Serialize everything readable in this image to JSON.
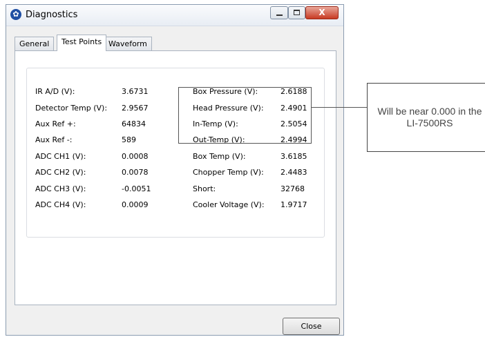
{
  "window": {
    "title": "Diagnostics",
    "close_glyph": "X"
  },
  "tabs": [
    {
      "label": "General"
    },
    {
      "label": "Test Points"
    },
    {
      "label": "Waveform"
    }
  ],
  "test_points": {
    "left": [
      {
        "label": "IR A/D (V):",
        "value": "3.6731"
      },
      {
        "label": "Detector Temp (V):",
        "value": "2.9567"
      },
      {
        "label": "Aux Ref +:",
        "value": "64834"
      },
      {
        "label": "Aux Ref -:",
        "value": "589"
      },
      {
        "label": "ADC CH1 (V):",
        "value": "0.0008"
      },
      {
        "label": "ADC CH2 (V):",
        "value": "0.0078"
      },
      {
        "label": "ADC CH3 (V):",
        "value": "-0.0051"
      },
      {
        "label": "ADC CH4 (V):",
        "value": "0.0009"
      }
    ],
    "right": [
      {
        "label": "Box Pressure (V):",
        "value": "2.6188"
      },
      {
        "label": "Head Pressure (V):",
        "value": "2.4901"
      },
      {
        "label": "In-Temp (V):",
        "value": "2.5054"
      },
      {
        "label": "Out-Temp (V):",
        "value": "2.4994"
      },
      {
        "label": "Box Temp (V):",
        "value": "3.6185"
      },
      {
        "label": "Chopper Temp (V):",
        "value": "2.4483"
      },
      {
        "label": "Short:",
        "value": "32768"
      },
      {
        "label": "Cooler Voltage (V):",
        "value": "1.9717"
      }
    ]
  },
  "buttons": {
    "close": "Close"
  },
  "callout": {
    "text": "Will be near 0.000 in the LI-7500RS"
  }
}
